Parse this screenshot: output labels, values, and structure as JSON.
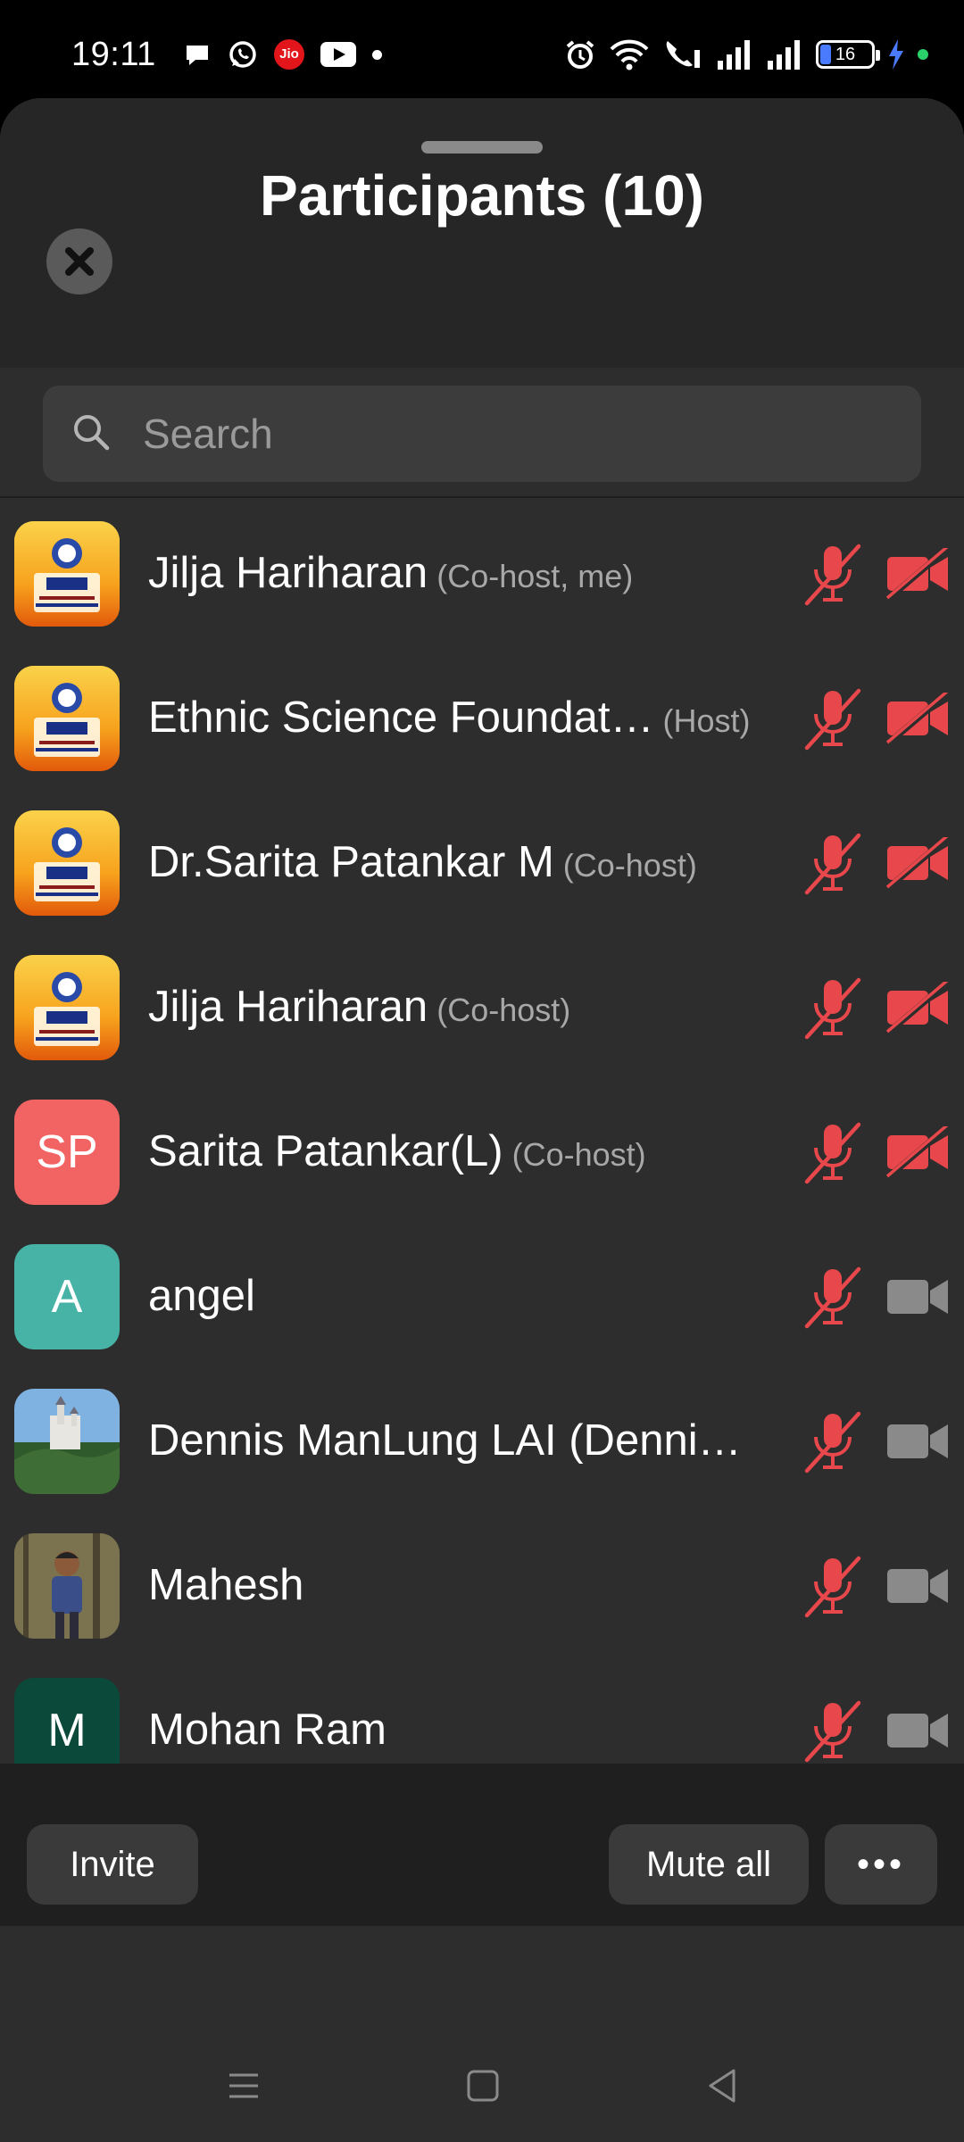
{
  "status_bar": {
    "time": "19:11",
    "battery": "16",
    "left_icons": [
      "message-icon",
      "whatsapp-icon",
      "jio-icon",
      "youtube-icon",
      "dot-icon"
    ],
    "jio_label": "Jio",
    "right_icons": [
      "alarm-icon",
      "wifi-icon",
      "wifi-call-icon",
      "signal-icon",
      "signal-icon",
      "battery-icon",
      "charging-icon"
    ]
  },
  "sheet": {
    "title": "Participants (10)",
    "search_placeholder": "Search"
  },
  "participants": [
    {
      "name": "Jilja Hariharan",
      "role": "(Co-host, me)",
      "avatar_type": "logo",
      "mic": "muted",
      "video": "off"
    },
    {
      "name": "Ethnic Science Foundat…",
      "role": "(Host)",
      "avatar_type": "logo",
      "mic": "muted",
      "video": "off"
    },
    {
      "name": "Dr.Sarita Patankar M",
      "role": "(Co-host)",
      "avatar_type": "logo",
      "mic": "muted",
      "video": "off"
    },
    {
      "name": "Jilja Hariharan",
      "role": "(Co-host)",
      "avatar_type": "logo",
      "mic": "muted",
      "video": "off"
    },
    {
      "name": "Sarita Patankar(L)",
      "role": "(Co-host)",
      "avatar_type": "initials",
      "initials": "SP",
      "avatar_color": "#f26363",
      "mic": "muted",
      "video": "off"
    },
    {
      "name": "angel",
      "role": "",
      "avatar_type": "initials",
      "initials": "A",
      "avatar_color": "#46b3a6",
      "mic": "muted",
      "video": "on"
    },
    {
      "name": "Dennis ManLung LAI (Denni…",
      "role": "",
      "avatar_type": "photo-castle",
      "mic": "muted",
      "video": "on"
    },
    {
      "name": "Mahesh",
      "role": "",
      "avatar_type": "photo-person",
      "mic": "muted",
      "video": "on"
    },
    {
      "name": "Mohan Ram",
      "role": "",
      "avatar_type": "initials",
      "initials": "M",
      "avatar_color": "#0b4a3a",
      "mic": "muted",
      "video": "on"
    },
    {
      "name": "",
      "role": "",
      "avatar_type": "initials",
      "initials": "",
      "avatar_color": "#a6d38a",
      "mic": "muted",
      "video": "on"
    }
  ],
  "bottom": {
    "invite_label": "Invite",
    "mute_all_label": "Mute all",
    "more_label": "•••"
  },
  "colors": {
    "muted_red": "#e8474b",
    "sheet_bg": "#2d2d2d",
    "icon_grey": "#8a8a8a"
  }
}
